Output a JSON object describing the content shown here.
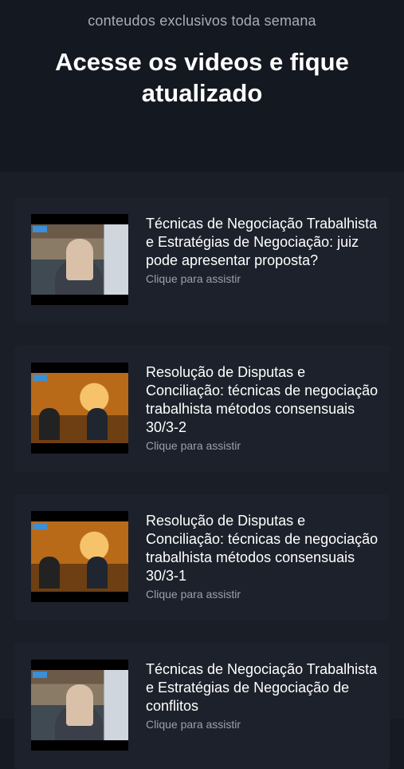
{
  "header": {
    "subtitle": "conteudos exclusivos toda semana",
    "title": "Acesse os videos e fique atualizado"
  },
  "videos": [
    {
      "title": "Técnicas de Negociação Trabalhista e Estratégias de Negociação: juiz pode apresentar proposta?",
      "cta": "Clique para assistir",
      "thumb": "office"
    },
    {
      "title": "Resolução de Disputas e Conciliação: técnicas de negociação trabalhista métodos consensuais 30/3-2",
      "cta": "Clique para assistir",
      "thumb": "studio"
    },
    {
      "title": "Resolução de Disputas e Conciliação: técnicas de negociação trabalhista métodos consensuais 30/3-1",
      "cta": "Clique para assistir",
      "thumb": "studio"
    },
    {
      "title": "Técnicas de Negociação Trabalhista e Estratégias de Negociação de conflitos",
      "cta": "Clique para assistir",
      "thumb": "office"
    }
  ],
  "colors": {
    "background": "#161a22",
    "card": "#1d212b",
    "muted": "#9aa0aa"
  }
}
